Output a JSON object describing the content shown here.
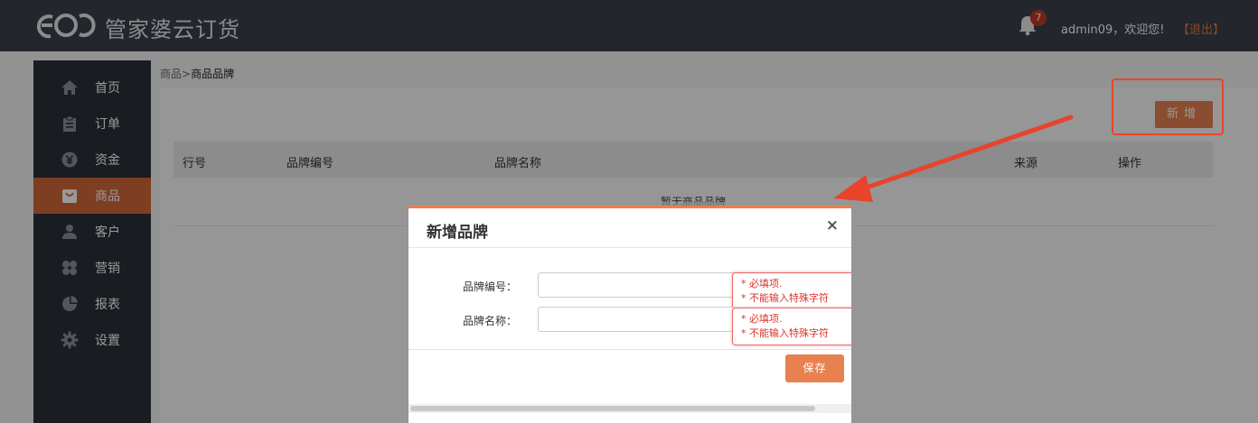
{
  "header": {
    "app_name": "管家婆云订货",
    "notification_count": "7",
    "welcome_text": "admin09，欢迎您!",
    "logout_label": "【退出】"
  },
  "sidebar": {
    "items": [
      {
        "label": "首页",
        "icon": "home-icon"
      },
      {
        "label": "订单",
        "icon": "clipboard-icon"
      },
      {
        "label": "资金",
        "icon": "yen-coin-icon"
      },
      {
        "label": "商品",
        "icon": "shopping-bag-icon",
        "active": true
      },
      {
        "label": "客户",
        "icon": "person-icon"
      },
      {
        "label": "营销",
        "icon": "clover-icon"
      },
      {
        "label": "报表",
        "icon": "pie-chart-icon"
      },
      {
        "label": "设置",
        "icon": "gear-icon"
      }
    ]
  },
  "breadcrumb": {
    "parent": "商品",
    "separator": ">",
    "current": "商品品牌"
  },
  "toolbar": {
    "add_label": "新增"
  },
  "table": {
    "columns": [
      "行号",
      "品牌编号",
      "品牌名称",
      "来源",
      "操作"
    ],
    "empty_text": "暂无商品品牌"
  },
  "modal": {
    "title": "新增品牌",
    "close_symbol": "×",
    "fields": [
      {
        "label": "品牌编号：",
        "value": "",
        "errors": [
          "* 必填项.",
          "* 不能输入特殊字符"
        ]
      },
      {
        "label": "品牌名称：",
        "value": "",
        "errors": [
          "* 必填项.",
          "* 不能输入特殊字符"
        ]
      }
    ],
    "save_label": "保存"
  },
  "colors": {
    "accent": "#e8814f",
    "header_bg": "#3b404b",
    "sidebar_bg": "#2b2f38",
    "annotation_red": "#e8442c"
  }
}
